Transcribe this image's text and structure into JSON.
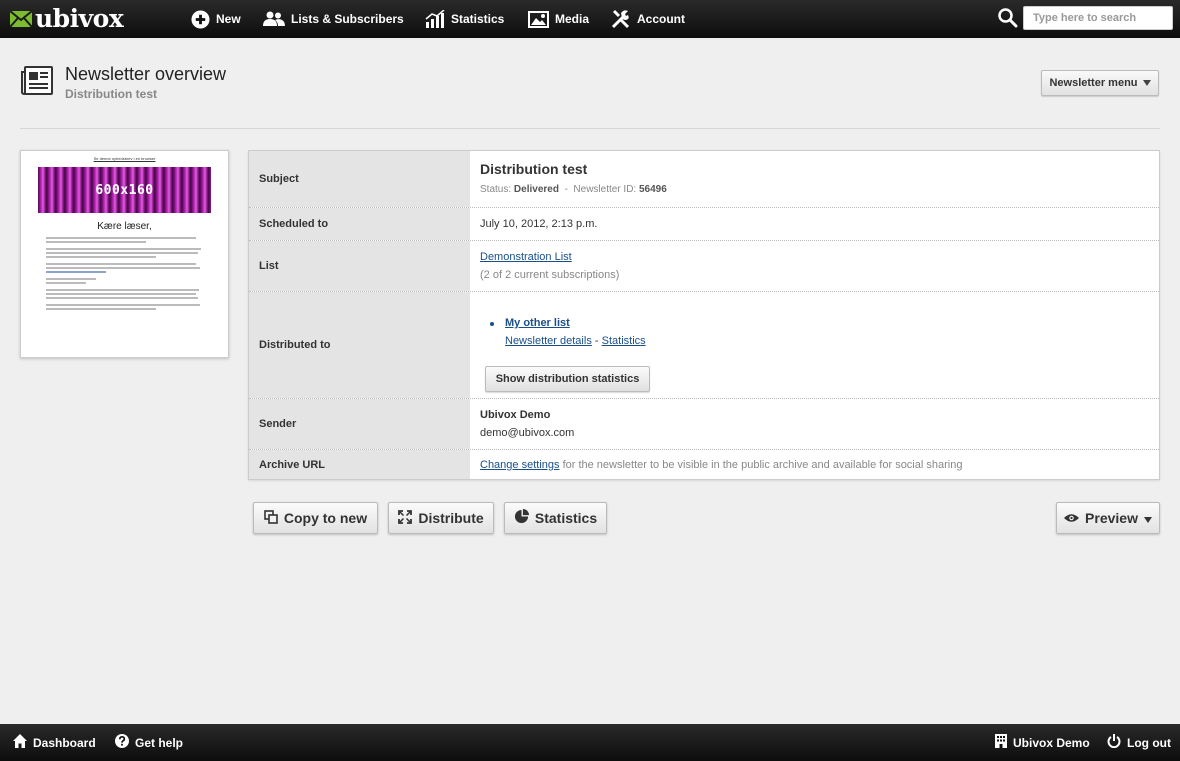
{
  "app": {
    "logo_text": "ubivox"
  },
  "topnav": {
    "items": [
      {
        "label": "New",
        "icon": "plus-circle-icon"
      },
      {
        "label": "Lists & Subscribers",
        "icon": "users-icon"
      },
      {
        "label": "Statistics",
        "icon": "bar-chart-icon"
      },
      {
        "label": "Media",
        "icon": "image-icon"
      },
      {
        "label": "Account",
        "icon": "tools-icon"
      }
    ],
    "search_placeholder": "Type here to search",
    "search_value": ""
  },
  "header": {
    "title": "Newsletter overview",
    "subtitle": "Distribution test",
    "menu_button": "Newsletter menu"
  },
  "thumbnail": {
    "top_link": "Se denne nyhedsbrev i en browser",
    "banner_text": "600x160",
    "greeting": "Kære læser,"
  },
  "details": {
    "subject": {
      "label": "Subject",
      "title": "Distribution test",
      "status_label": "Status:",
      "status_value": "Delivered",
      "separator": "-",
      "id_label": "Newsletter ID:",
      "id_value": "56496"
    },
    "scheduled": {
      "label": "Scheduled to",
      "value": "July 10, 2012, 2:13 p.m."
    },
    "list": {
      "label": "List",
      "link": "Demonstration List",
      "note": "(2 of 2 current subscriptions)"
    },
    "distributed": {
      "label": "Distributed to",
      "list_name": "My other list",
      "details_link": "Newsletter details",
      "link_separator": "-",
      "statistics_link": "Statistics",
      "button": "Show distribution statistics"
    },
    "sender": {
      "label": "Sender",
      "name": "Ubivox Demo",
      "email": "demo@ubivox.com"
    },
    "archive": {
      "label": "Archive URL",
      "link": "Change settings",
      "text": "for the newsletter to be visible in the public archive and available for social sharing"
    }
  },
  "actions": {
    "copy": "Copy to new",
    "distribute": "Distribute",
    "statistics": "Statistics",
    "preview": "Preview"
  },
  "footer": {
    "dashboard": "Dashboard",
    "help": "Get help",
    "account": "Ubivox Demo",
    "logout": "Log out"
  },
  "colors": {
    "bar_background": "#111111",
    "page_background": "#efefef",
    "label_background": "#e4e4e4",
    "link": "#1a4f8a",
    "logo_green": "#7dbb2e"
  }
}
